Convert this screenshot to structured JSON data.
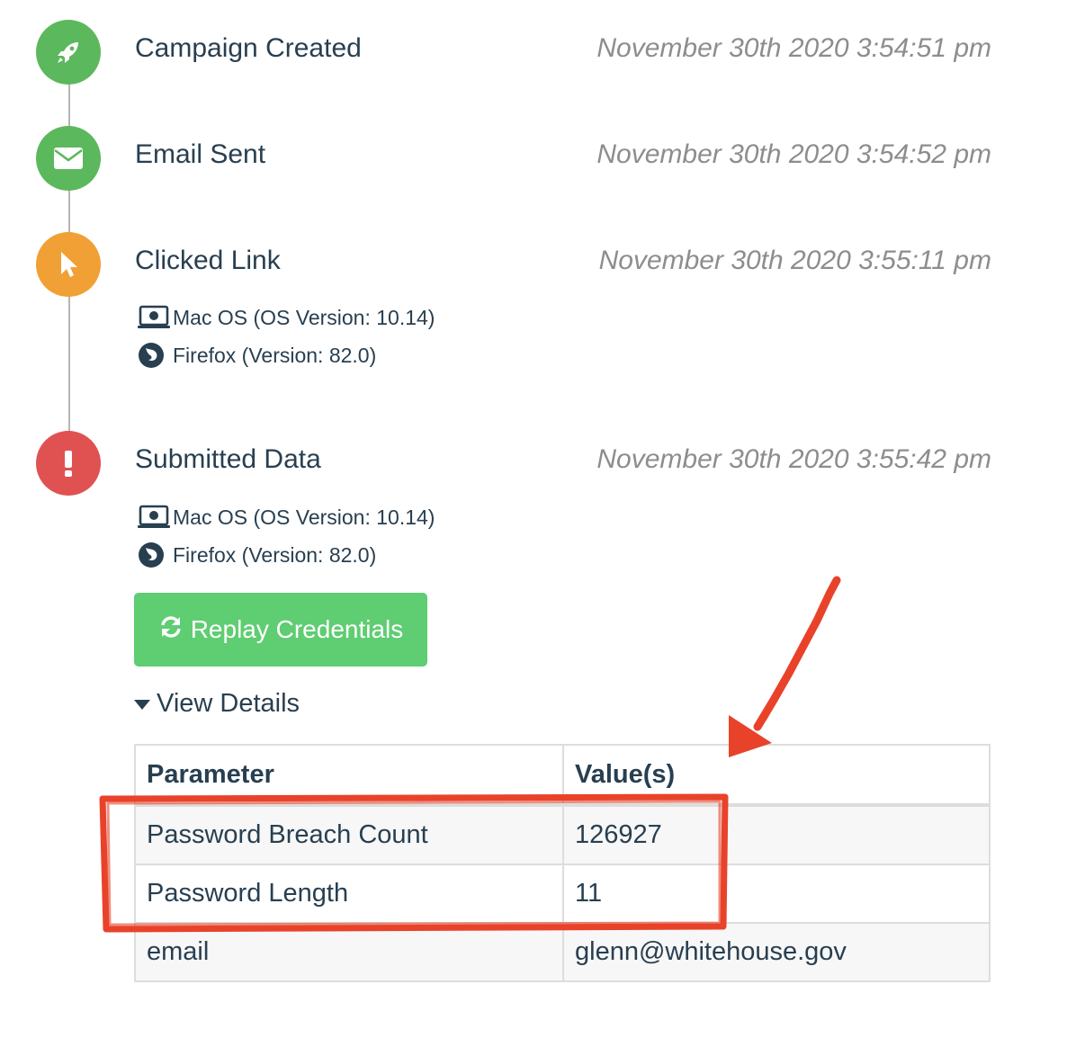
{
  "timeline": {
    "events": [
      {
        "title": "Campaign Created",
        "time": "November 30th 2020 3:54:51 pm",
        "color": "#5cb85c",
        "icon": "rocket-icon"
      },
      {
        "title": "Email Sent",
        "time": "November 30th 2020 3:54:52 pm",
        "color": "#5cb85c",
        "icon": "envelope-icon"
      },
      {
        "title": "Clicked Link",
        "time": "November 30th 2020 3:55:11 pm",
        "color": "#f0a035",
        "icon": "cursor-icon",
        "os": "Mac OS (OS Version: 10.14)",
        "browser": "Firefox (Version: 82.0)"
      },
      {
        "title": "Submitted Data",
        "time": "November 30th 2020 3:55:42 pm",
        "color": "#e05252",
        "icon": "exclamation-icon",
        "os": "Mac OS (OS Version: 10.14)",
        "browser": "Firefox (Version: 82.0)"
      }
    ]
  },
  "actions": {
    "replay_label": "Replay Credentials",
    "replay_color": "#5fcd72",
    "view_details_label": "View Details"
  },
  "details_table": {
    "headers": [
      "Parameter",
      "Value(s)"
    ],
    "rows": [
      [
        "Password Breach Count",
        "126927"
      ],
      [
        "Password Length",
        "11"
      ],
      [
        "email",
        "glenn@whitehouse.gov"
      ]
    ]
  },
  "annotation": {
    "color": "#e8432a"
  }
}
